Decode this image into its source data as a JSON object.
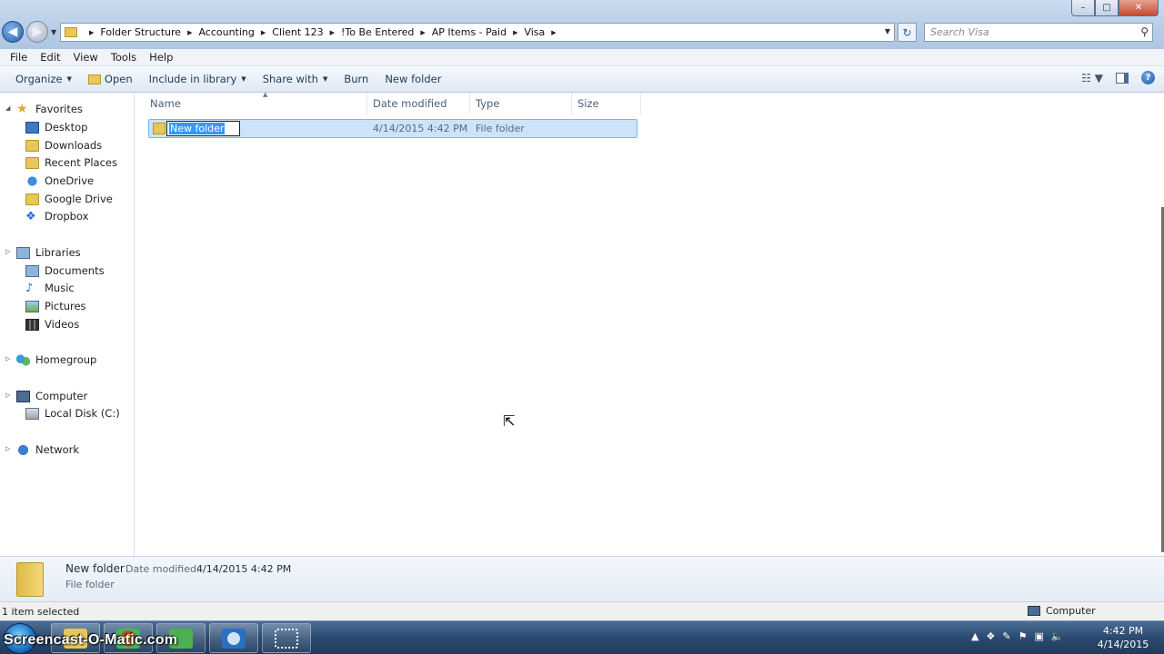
{
  "window": {
    "min": "–",
    "max": "□",
    "close": "✕"
  },
  "address": {
    "breadcrumbs": [
      "Folder Structure",
      "Accounting",
      "Client 123",
      "!To Be Entered",
      "AP Items - Paid",
      "Visa"
    ],
    "search_placeholder": "Search Visa"
  },
  "menu": [
    "File",
    "Edit",
    "View",
    "Tools",
    "Help"
  ],
  "toolbar": {
    "organize": "Organize",
    "open": "Open",
    "include_in_library": "Include in library",
    "share_with": "Share with",
    "burn": "Burn",
    "new_folder": "New folder"
  },
  "nav": {
    "favorites": "Favorites",
    "desktop": "Desktop",
    "downloads": "Downloads",
    "recent_places": "Recent Places",
    "onedrive": "OneDrive",
    "google_drive": "Google Drive",
    "dropbox": "Dropbox",
    "libraries": "Libraries",
    "documents": "Documents",
    "music": "Music",
    "pictures": "Pictures",
    "videos": "Videos",
    "homegroup": "Homegroup",
    "computer": "Computer",
    "local_disk": "Local Disk (C:)",
    "network": "Network"
  },
  "columns": {
    "name": "Name",
    "date_modified": "Date modified",
    "type": "Type",
    "size": "Size"
  },
  "files": [
    {
      "name": "New folder",
      "date_modified": "4/14/2015 4:42 PM",
      "type": "File folder",
      "size": ""
    }
  ],
  "details": {
    "name": "New folder",
    "date_label": "Date modified:",
    "date_value": "4/14/2015 4:42 PM",
    "type": "File folder"
  },
  "status": {
    "selection": "1 item selected",
    "location": "Computer"
  },
  "taskbar": {
    "watermark": "Screencast-O-Matic.com",
    "time": "4:42 PM",
    "date": "4/14/2015"
  },
  "colors": {
    "selection": "#cce4fb",
    "selection_border": "#7fb5e6",
    "rename_highlight": "#3399ff",
    "taskbar": "#2b4a70"
  }
}
